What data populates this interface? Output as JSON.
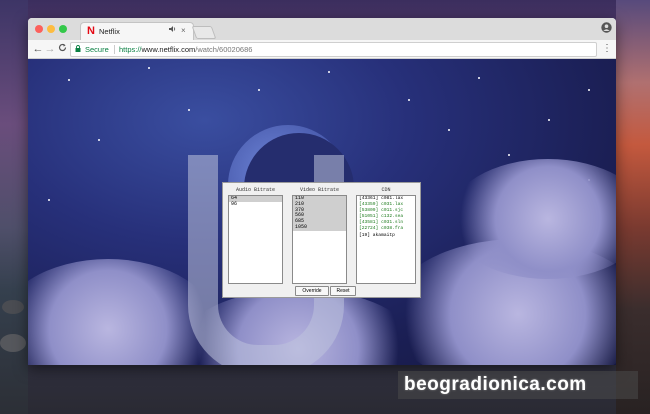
{
  "browser": {
    "tab_title": "Netflix",
    "tab_logo": "N",
    "tab_audio_icon": "speaker-icon",
    "tab_close": "×",
    "profile_icon": "person-icon",
    "menu_icon": "⋮",
    "secure_label": "Secure",
    "url_proto": "https://",
    "url_host": "www.netflix.com",
    "url_path": "/watch/60020686",
    "nav": {
      "back": "←",
      "forward": "→",
      "reload": "C"
    },
    "colors": {
      "secure": "#0b8043",
      "netflix_red": "#e50914"
    }
  },
  "dialog": {
    "audio_header": "Audio Bitrate",
    "video_header": "Video Bitrate",
    "cdn_header": "CDN",
    "audio_options": [
      "64",
      "96"
    ],
    "video_options": [
      "110",
      "210",
      "370",
      "560",
      "685",
      "1050"
    ],
    "cdn_options": [
      {
        "prefix": "[43361]",
        "host": "c081.lax"
      },
      {
        "prefix": "[43359]",
        "host": "c031.lax"
      },
      {
        "prefix": "[53809]",
        "host": "c011.sjc"
      },
      {
        "prefix": "[51051]",
        "host": "c132.sea"
      },
      {
        "prefix": "[43581]",
        "host": "c031.sln"
      },
      {
        "prefix": "[22724]",
        "host": "c038.fra"
      },
      {
        "prefix": "[19]",
        "host": "akamaitp"
      }
    ],
    "override_label": "Override",
    "reset_label": "Reset"
  },
  "watermark": {
    "text": "beogradionica.com"
  }
}
